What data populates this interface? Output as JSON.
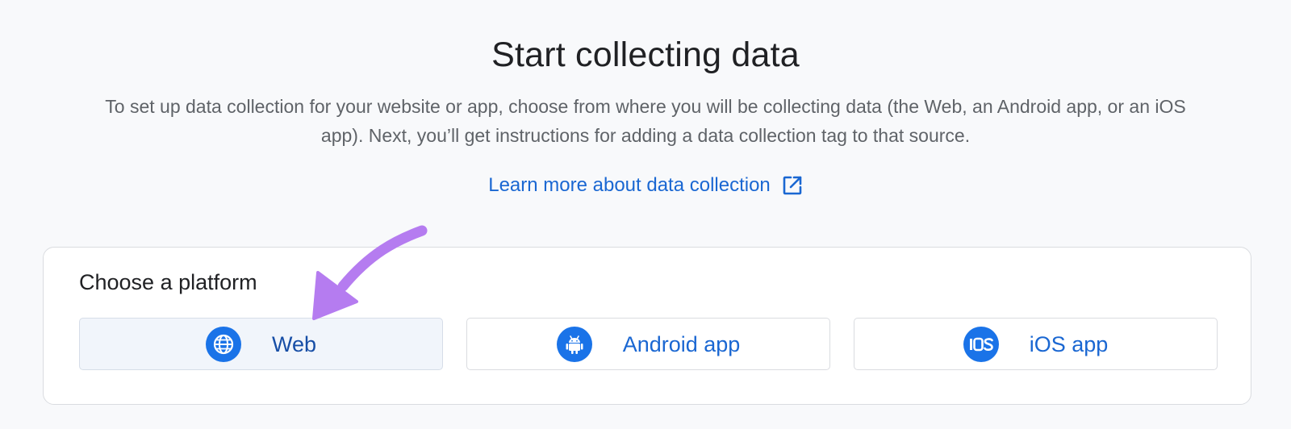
{
  "header": {
    "title": "Start collecting data",
    "description": "To set up data collection for your website or app, choose from where you will be collecting data (the Web, an Android app, or an iOS app). Next, you’ll get instructions for adding a data collection tag to that source.",
    "learn_more_label": "Learn more about data collection",
    "learn_more_icon": "external-link-icon"
  },
  "platform_card": {
    "heading": "Choose a platform",
    "options": [
      {
        "label": "Web",
        "icon": "globe-icon",
        "selected": true
      },
      {
        "label": "Android app",
        "icon": "android-icon",
        "selected": false
      },
      {
        "label": "iOS app",
        "icon": "ios-icon",
        "selected": false
      }
    ]
  },
  "annotation": {
    "arrow_icon": "curved-arrow-icon",
    "arrow_color": "#b57cf0"
  },
  "colors": {
    "accent": "#1a73e8",
    "link": "#1a67d2",
    "background": "#f8f9fb"
  }
}
